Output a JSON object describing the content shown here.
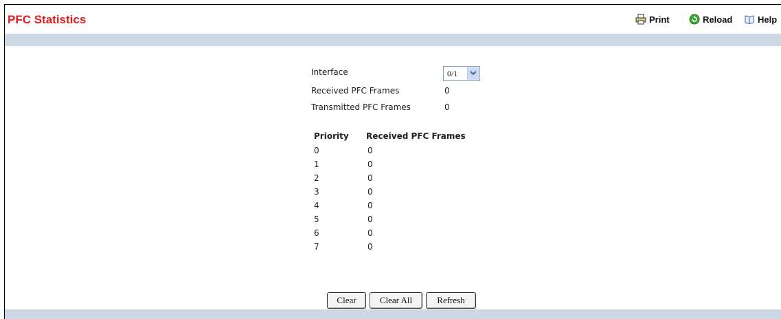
{
  "header": {
    "title": "PFC Statistics",
    "tools": {
      "print": "Print",
      "reload": "Reload",
      "help": "Help"
    }
  },
  "form": {
    "interface_label": "Interface",
    "interface_value": "0/1",
    "received_label": "Received PFC Frames",
    "received_value": "0",
    "transmitted_label": "Transmitted PFC Frames",
    "transmitted_value": "0"
  },
  "table": {
    "headers": [
      "Priority",
      "Received PFC Frames"
    ],
    "rows": [
      [
        "0",
        "0"
      ],
      [
        "1",
        "0"
      ],
      [
        "2",
        "0"
      ],
      [
        "3",
        "0"
      ],
      [
        "4",
        "0"
      ],
      [
        "5",
        "0"
      ],
      [
        "6",
        "0"
      ],
      [
        "7",
        "0"
      ]
    ]
  },
  "buttons": {
    "clear": "Clear",
    "clear_all": "Clear All",
    "refresh": "Refresh"
  },
  "colors": {
    "title": "#e31c1c",
    "band": "#ccd8e3"
  }
}
